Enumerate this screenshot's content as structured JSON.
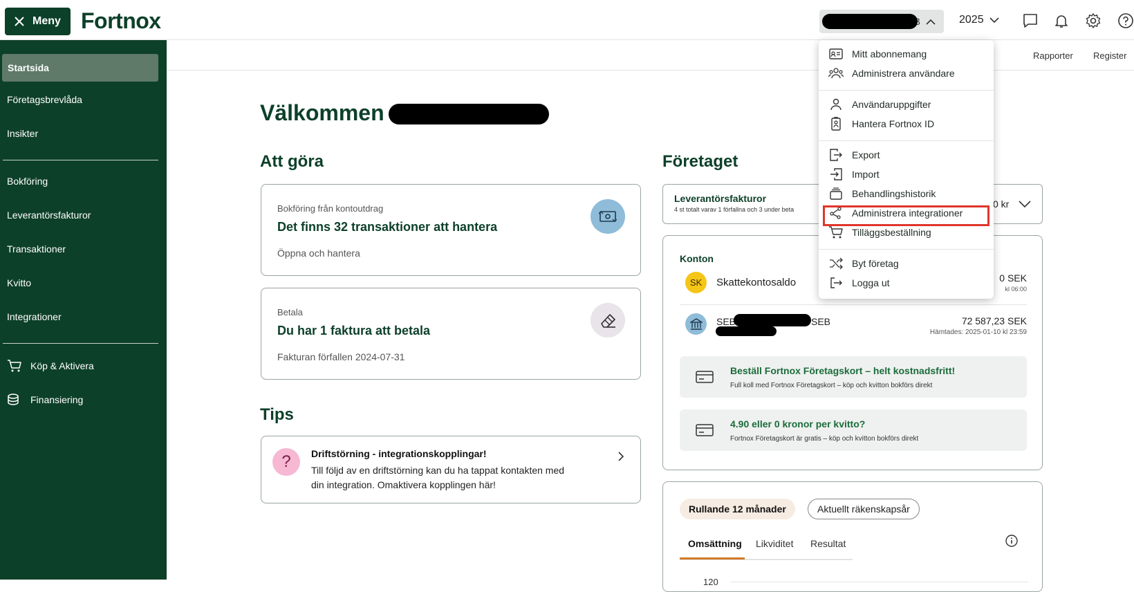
{
  "topbar": {
    "menu_label": "Meny",
    "logo": "Fortnox",
    "company_suffix": "AB",
    "year": "2025"
  },
  "sidebar": {
    "items": [
      {
        "label": "Startsida"
      },
      {
        "label": "Företagsbrevlåda"
      },
      {
        "label": "Insikter"
      },
      {
        "label": "Bokföring"
      },
      {
        "label": "Leverantörsfakturor"
      },
      {
        "label": "Transaktioner"
      },
      {
        "label": "Kvitto"
      },
      {
        "label": "Integrationer"
      },
      {
        "label": "Köp & Aktivera"
      },
      {
        "label": "Finansiering"
      }
    ]
  },
  "subhead": {
    "rapporter": "Rapporter",
    "register": "Register"
  },
  "main": {
    "welcome": "Välkommen",
    "todo_title": "Att göra",
    "cards": [
      {
        "sub": "Bokföring från kontoutdrag",
        "title": "Det finns 32 transaktioner att hantera",
        "link": "Öppna och hantera"
      },
      {
        "sub": "Betala",
        "title": "Du har 1 faktura att betala",
        "link": "Fakturan förfallen 2024-07-31"
      }
    ],
    "tips_title": "Tips",
    "tip": {
      "mark": "?",
      "title": "Driftstörning - integrationskopplingar!",
      "text1": "Till följd av en driftstörning kan du ha tappat kontakten med",
      "text2": "din integration. Omaktivera kopplingen här!"
    }
  },
  "company": {
    "title": "Företaget",
    "lev_title": "Leverantörsfakturor",
    "lev_sub": "4 st totalt varav 1 förfallna och 3 under beta",
    "lev_amount": "0 kr",
    "konton_title": "Konton",
    "accounts": [
      {
        "badge": "SK",
        "name": "Skattekontosaldo",
        "amount": "0 SEK",
        "time": "kl 06:00"
      },
      {
        "badge": "",
        "name": "SEB",
        "name_tail": "SEB",
        "amount": "72 587,23 SEK",
        "time": "Hämtades: 2025-01-10 kl 23:59"
      }
    ],
    "promos": [
      {
        "title": "Beställ Fortnox Företagskort – helt kostnadsfritt!",
        "text": "Full koll med Fortnox Företagskort – köp och kvitton bokförs direkt"
      },
      {
        "title": "4.90 eller 0 kronor per kvitto?",
        "text": "Fortnox Företagskort är gratis – köp och kvitton bokförs direkt"
      }
    ],
    "period_active": "Rullande 12 månader",
    "period_other": "Aktuellt räkenskapsår",
    "tabs": [
      "Omsättning",
      "Likviditet",
      "Resultat"
    ],
    "axis_tick": "120"
  },
  "dropdown": {
    "items": [
      {
        "label": "Mitt abonnemang",
        "icon": "id-card-icon"
      },
      {
        "label": "Administrera användare",
        "icon": "users-icon"
      },
      {
        "label": "Användaruppgifter",
        "icon": "user-icon"
      },
      {
        "label": "Hantera Fortnox ID",
        "icon": "badge-icon"
      },
      {
        "label": "Export",
        "icon": "export-icon"
      },
      {
        "label": "Import",
        "icon": "import-icon"
      },
      {
        "label": "Behandlingshistorik",
        "icon": "history-icon"
      },
      {
        "label": "Administrera integrationer",
        "icon": "integrations-icon"
      },
      {
        "label": "Tilläggsbeställning",
        "icon": "cart-icon"
      },
      {
        "label": "Byt företag",
        "icon": "shuffle-icon"
      },
      {
        "label": "Logga ut",
        "icon": "logout-icon"
      }
    ]
  },
  "colors": {
    "brand": "#0d4029",
    "highlight": "#e0352b",
    "accent_green": "#1b6b3a"
  }
}
